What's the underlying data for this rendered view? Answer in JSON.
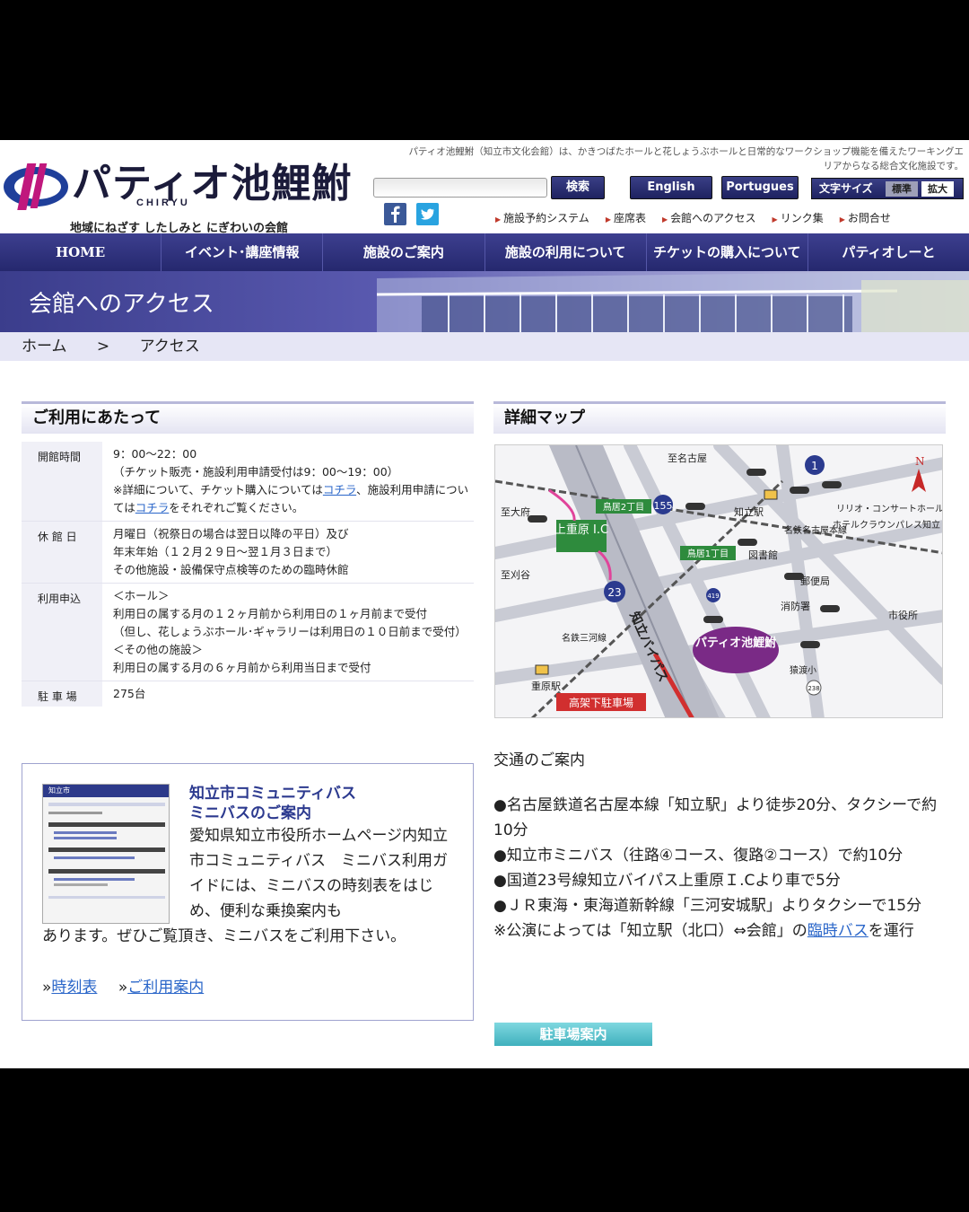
{
  "header": {
    "logo_text": "パティオ池鯉鮒",
    "logo_roman": "CHIRYU",
    "tagline": "地域にねざす したしみと にぎわいの会館",
    "site_description": "パティオ池鯉鮒（知立市文化会館）は、かきつばたホールと花しょうぶホールと日常的なワークショップ機能を備えたワーキングエリアからなる総合文化施設です。",
    "search_button": "検索",
    "english_button": "English",
    "portugues_button": "Portugues",
    "font_size_label": "文字サイズ",
    "font_size_normal": "標準",
    "font_size_large": "拡大",
    "quick_links": [
      "施設予約システム",
      "座席表",
      "会館へのアクセス",
      "リンク集",
      "お問合せ"
    ]
  },
  "nav": [
    "HOME",
    "イベント･講座情報",
    "施設のご案内",
    "施設の利用について",
    "チケットの購入について",
    "パティオしーと"
  ],
  "banner_title": "会館へのアクセス",
  "breadcrumb": {
    "home": "ホーム",
    "sep": ">",
    "current": "アクセス"
  },
  "usage": {
    "heading": "ご利用にあたって",
    "rows": [
      {
        "label": "開館時間",
        "lines": [
          "9：00～22：00",
          "（チケット販売・施設利用申請受付は9：00～19：00）"
        ],
        "note_pre": "※詳細について、チケット購入については",
        "link1": "コチラ",
        "note_mid": "、施設利用申請については",
        "link2": "コチラ",
        "note_post": "をそれぞれご覧ください。"
      },
      {
        "label": "休 館 日",
        "lines": [
          "月曜日（祝祭日の場合は翌日以降の平日）及び",
          "年末年始（１２月２９日～翌１月３日まで）",
          "その他施設・設備保守点検等のための臨時休館"
        ]
      },
      {
        "label": "利用申込",
        "lines": [
          "＜ホール＞",
          "利用日の属する月の１２ヶ月前から利用日の１ヶ月前まで受付",
          "（但し、花しょうぶホール･ギャラリーは利用日の１０日前まで受付）",
          "＜その他の施設＞",
          "利用日の属する月の６ヶ月前から利用当日まで受付"
        ]
      },
      {
        "label": "駐 車 場",
        "lines": [
          "275台"
        ]
      }
    ]
  },
  "bus": {
    "title1": "知立市コミュニティバス",
    "title2": "ミニバスのご案内",
    "text": "愛知県知立市役所ホームページ内知立市コミュニティバス　ミニバス利用ガイドには、ミニバスの時刻表をはじめ、便利な乗換案内も",
    "text2": "あります。ぜひご覧頂き、ミニバスをご利用下さい。",
    "link_timetable": "時刻表",
    "link_guide": "ご利用案内",
    "thumb_title": "知立市"
  },
  "map": {
    "heading": "詳細マップ",
    "labels": {
      "nagoya_dir": "至名古屋",
      "okazaki_dir": "至大府",
      "kariya_dir": "至刈谷",
      "ic": "上重原 I.C",
      "bypass": "知立バイパス",
      "chiryu_st": "知立駅",
      "shigehara_st": "重原駅",
      "mikawa_line": "名鉄三河線",
      "nagoya_line": "名鉄名古屋本線",
      "torii2": "鳥居2丁目",
      "torii1": "鳥居1丁目",
      "library": "図書館",
      "post": "郵便局",
      "fire": "消防署",
      "city_hall": "市役所",
      "concert": "リリオ・コンサートホール",
      "hotel": "ホテルクラウンパレス知立",
      "sarunobami": "猿渡小",
      "patio": "パティオ池鯉鮒",
      "parking": "高架下駐車場",
      "route155": "155",
      "route23": "23",
      "route1": "1",
      "route419": "419",
      "route238": "238",
      "meiji": "名古屋"
    }
  },
  "access": {
    "title": "交通のご案内",
    "items": [
      "●名古屋鉄道名古屋本線「知立駅」より徒歩20分、タクシーで約10分",
      "●知立市ミニバス（往路④コース、復路②コース）で約10分",
      "●国道23号線知立バイパス上重原Ｉ.Cより車で5分",
      "●ＪＲ東海・東海道新幹線「三河安城駅」よりタクシーで15分"
    ],
    "note_pre": "※公演によっては「知立駅（北口）⇔会館」の",
    "note_link": "臨時バス",
    "note_post": "を運行",
    "parking_button": "駐車場案内"
  },
  "colors": {
    "nav": "#2f318a",
    "accent_link": "#2a66c9",
    "crumb_bg": "#e6e6f5",
    "map_red": "#c62828"
  }
}
